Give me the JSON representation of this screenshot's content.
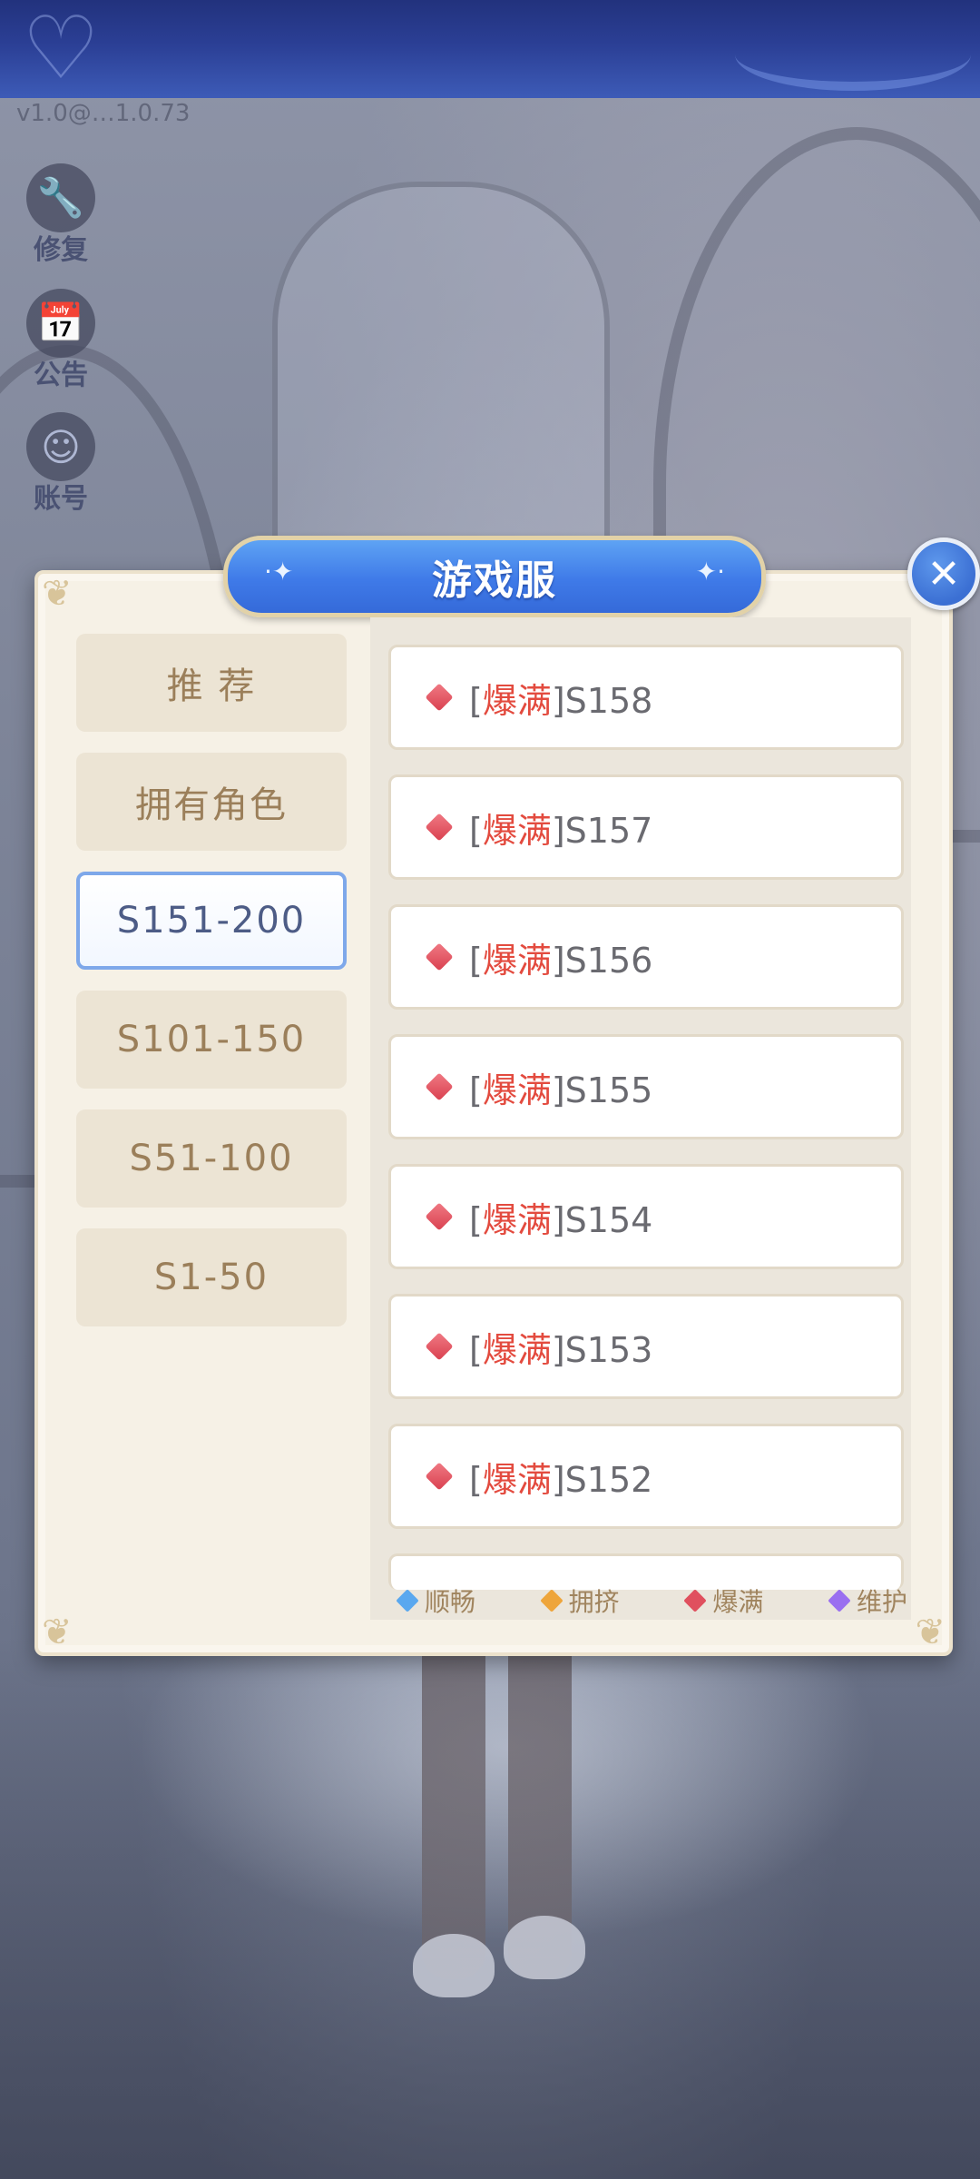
{
  "header": {
    "version": "v1.0@…1.0.73"
  },
  "side_menu": {
    "items": [
      {
        "label": "修复",
        "icon": "wrench-icon",
        "glyph": "🔧"
      },
      {
        "label": "公告",
        "icon": "calendar-icon",
        "glyph": "📅"
      },
      {
        "label": "账号",
        "icon": "avatar-icon",
        "glyph": "☺"
      }
    ]
  },
  "dialog": {
    "title": "游戏服",
    "close_glyph": "✕",
    "categories": [
      {
        "label": "推 荐",
        "active": false
      },
      {
        "label": "拥有角色",
        "active": false
      },
      {
        "label": "S151-200",
        "active": true
      },
      {
        "label": "S101-150",
        "active": false
      },
      {
        "label": "S51-100",
        "active": false
      },
      {
        "label": "S1-50",
        "active": false
      }
    ],
    "servers": [
      {
        "status": "爆满",
        "name": "S158"
      },
      {
        "status": "爆满",
        "name": "S157"
      },
      {
        "status": "爆满",
        "name": "S156"
      },
      {
        "status": "爆满",
        "name": "S155"
      },
      {
        "status": "爆满",
        "name": "S154"
      },
      {
        "status": "爆满",
        "name": "S153"
      },
      {
        "status": "爆满",
        "name": "S152"
      }
    ],
    "legend": [
      {
        "label": "顺畅",
        "color": "#5aa8ef"
      },
      {
        "label": "拥挤",
        "color": "#eea53b"
      },
      {
        "label": "爆满",
        "color": "#e0505e"
      },
      {
        "label": "维护",
        "color": "#9a6ff0"
      }
    ]
  },
  "colors": {
    "accent_blue": "#3f7ae8",
    "status_full": "#e34b3f",
    "panel_bg": "#f6f1e6"
  }
}
